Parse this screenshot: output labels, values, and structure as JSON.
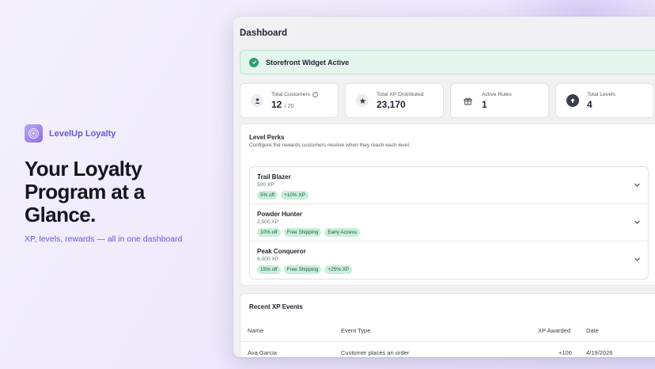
{
  "brand": {
    "name": "LevelUp Loyalty"
  },
  "hero": {
    "title": "Your Loyalty Program at a Glance.",
    "subtitle": "XP, levels, rewards — all in one dashboard"
  },
  "dashboard": {
    "title": "Dashboard",
    "banner": "Storefront Widget Active",
    "stats": [
      {
        "label": "Total Customers",
        "value": "12",
        "sub": "/ 20",
        "icon": "person-icon"
      },
      {
        "label": "Total XP Distributed",
        "value": "23,170",
        "sub": "",
        "icon": "star-icon"
      },
      {
        "label": "Active Rules",
        "value": "1",
        "sub": "",
        "icon": "gift-icon"
      },
      {
        "label": "Total Levels",
        "value": "4",
        "sub": "",
        "icon": "arrow-up-circle-icon"
      }
    ],
    "perks": {
      "title": "Level Perks",
      "description": "Configure the rewards customers receive when they reach each level.",
      "levels": [
        {
          "name": "Trail Blazer",
          "xp": "500 XP",
          "tags": [
            "5% off",
            "+10% XP"
          ]
        },
        {
          "name": "Powder Hunter",
          "xp": "2,500 XP",
          "tags": [
            "10% off",
            "Free Shipping",
            "Early Access"
          ]
        },
        {
          "name": "Peak Conqueror",
          "xp": "6,000 XP",
          "tags": [
            "15% off",
            "Free Shipping",
            "+25% XP"
          ]
        }
      ]
    },
    "events": {
      "title": "Recent XP Events",
      "columns": [
        "Name",
        "Event Type",
        "XP Awarded",
        "Date"
      ],
      "rows": [
        [
          "Ava Garcia",
          "Customer places an order",
          "+100",
          "4/19/2026"
        ]
      ]
    }
  },
  "colors": {
    "accent": "#6a55d8",
    "success": "#2f9e6c",
    "tag_bg": "#c9efd9"
  }
}
